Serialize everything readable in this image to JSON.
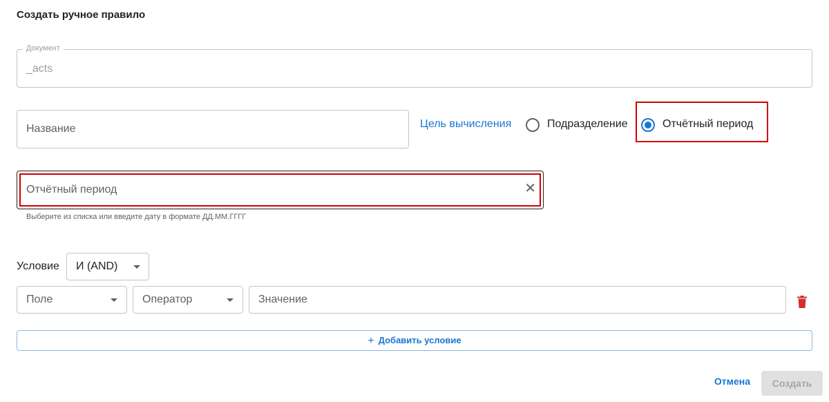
{
  "dialog": {
    "title": "Создать ручное правило",
    "document": {
      "label": "Документ",
      "value": "_acts"
    },
    "name": {
      "placeholder": "Название"
    },
    "target": {
      "label": "Цель вычисления",
      "options": [
        {
          "label": "Подразделение",
          "selected": false
        },
        {
          "label": "Отчётный период",
          "selected": true
        }
      ]
    },
    "period": {
      "placeholder": "Отчётный период",
      "helper": "Выберите из списка или введите дату в формате ДД.ММ.ГГГГ",
      "clear_icon": "close-icon"
    },
    "condition": {
      "label": "Условие",
      "logic": "И (AND)",
      "row": {
        "field": "Поле",
        "operator": "Оператор",
        "value": "Значение",
        "delete_icon": "trash-icon"
      },
      "add_label": "Добавить условие"
    },
    "actions": {
      "cancel": "Отмена",
      "create": "Создать"
    }
  },
  "colors": {
    "accent": "#1976d2",
    "highlight": "#d00000",
    "danger": "#d32f2f",
    "disabled_bg": "#e0e0e0"
  }
}
